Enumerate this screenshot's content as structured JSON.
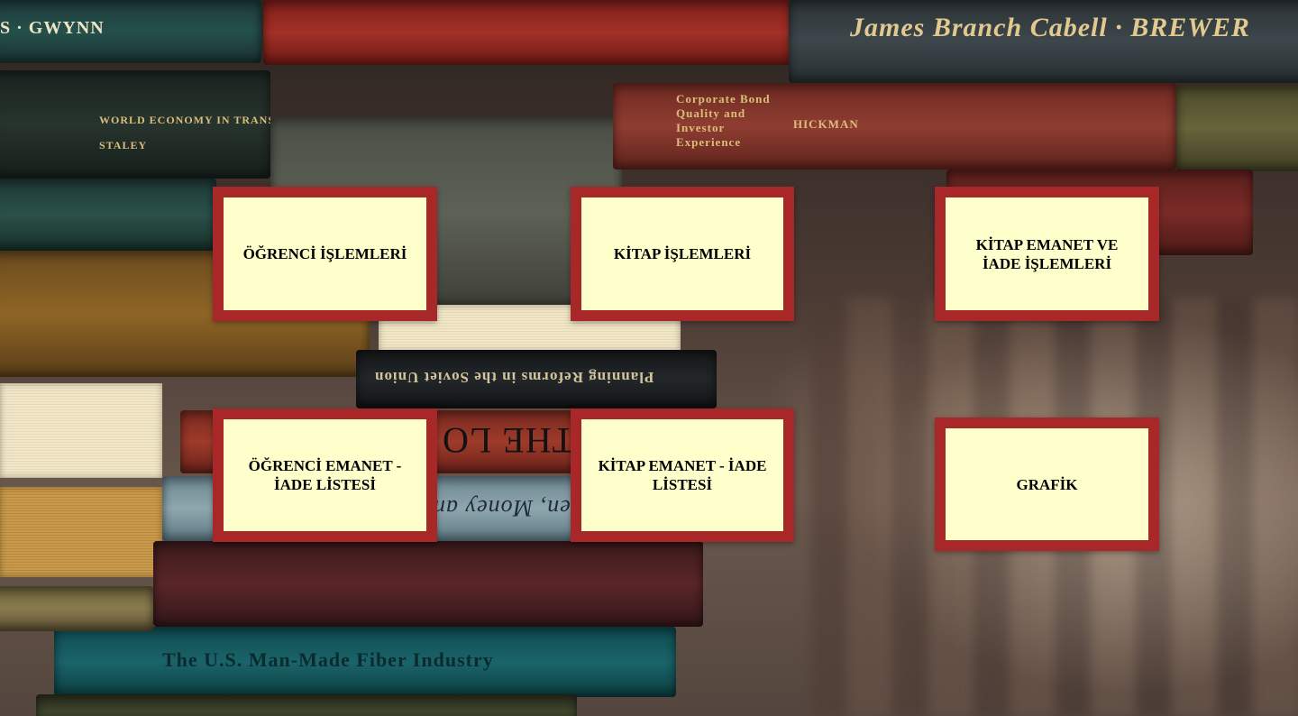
{
  "menu": {
    "tiles": [
      {
        "label": "ÖĞRENCİ İŞLEMLERİ"
      },
      {
        "label": "KİTAP İŞLEMLERİ"
      },
      {
        "label": "KİTAP EMANET VE İADE İŞLEMLERİ"
      },
      {
        "label": "ÖĞRENCİ EMANET - İADE LİSTESİ"
      },
      {
        "label": "KİTAP EMANET - İADE LİSTESİ"
      },
      {
        "label": "GRAFİK"
      }
    ]
  },
  "background": {
    "spine_texts": [
      "S · GWYNN",
      "James Branch Cabell · BREWER",
      "WORLD ECONOMY IN TRANSITION",
      "STALEY",
      "Corporate Bond Quality and Investor Experience",
      "HICKMAN",
      "Planning Reforms in the Soviet Union",
      "THE LO",
      "en, Money an",
      "The U.S. Man-Made Fiber Industry"
    ]
  },
  "colors": {
    "tile_fill": "#ffffcc",
    "tile_border": "#a8282a",
    "tile_text": "#000000"
  }
}
